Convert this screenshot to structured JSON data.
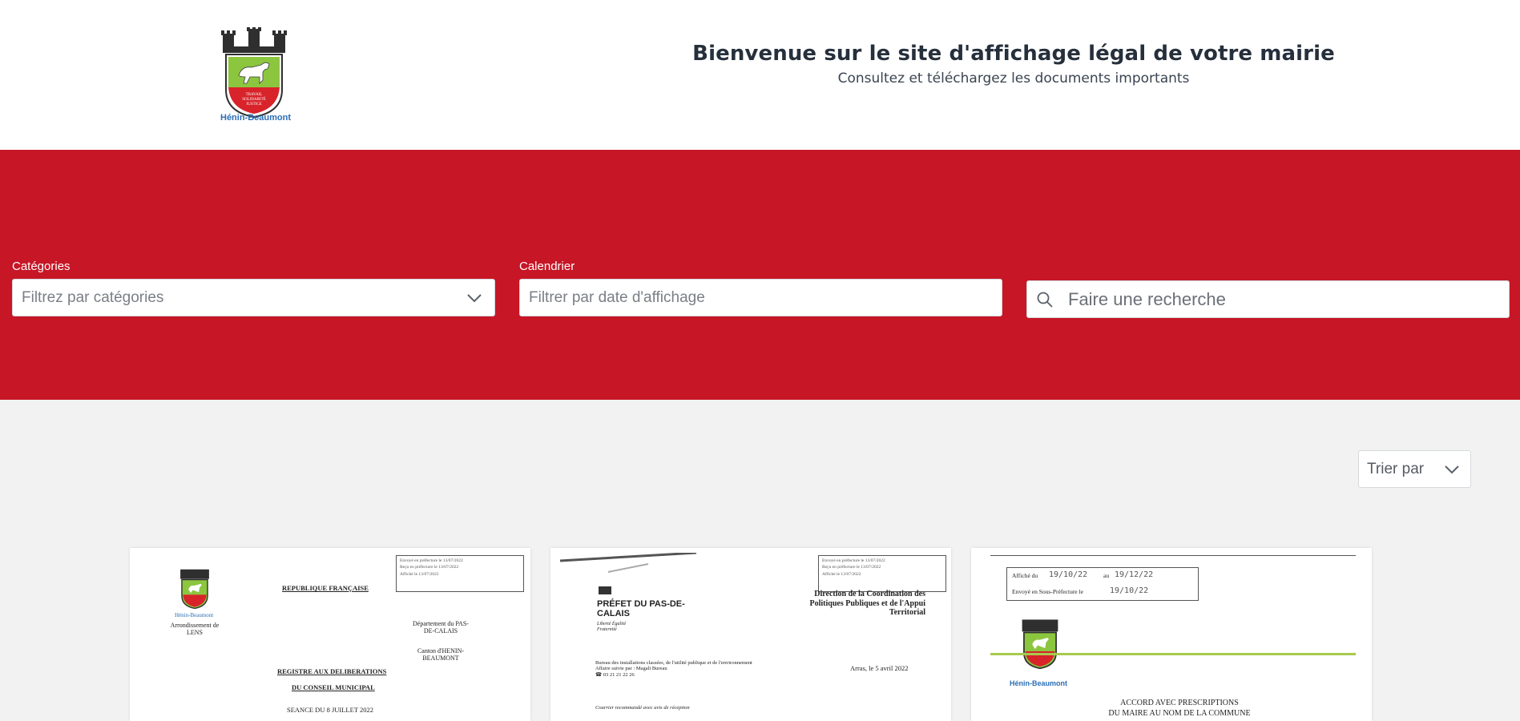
{
  "header": {
    "logo_caption": "Hénin-Beaumont",
    "logo_motto": "TRAVAIL SOLIDARITÉ JUSTICE",
    "title": "Bienvenue sur le site d'affichage légal de votre mairie",
    "subtitle": "Consultez et téléchargez les documents importants"
  },
  "filters": {
    "categories_label": "Catégories",
    "categories_placeholder": "Filtrez par catégories",
    "calendar_label": "Calendrier",
    "calendar_placeholder": "Filtrer par date d'affichage",
    "search_placeholder": "Faire une recherche"
  },
  "sort": {
    "label": "Trier par"
  },
  "cards": [
    {
      "republique": "REPUBLIQUE FRANÇAISE",
      "arrondissement": "Arrondissement de LENS",
      "departement": "Département du PAS-DE-CALAIS",
      "canton": "Canton d'HENIN-BEAUMONT",
      "registre": "REGISTRE AUX DELIBERATIONS",
      "conseil": "DU CONSEIL MUNICIPAL",
      "seance": "SEANCE DU 8 JUILLET 2022",
      "logo_caption": "Hénin-Beaumont"
    },
    {
      "prefet": "PRÉFET DU PAS-DE-CALAIS",
      "devise": "Liberté Égalité Fraternité",
      "direction": "Direction de la Coordination des Politiques Publiques et de l'Appui Territorial",
      "date": "Arras, le 5 avril 2022"
    },
    {
      "affiche_du": "Affiché du",
      "affiche_du_val": "19/10/22",
      "au": "au",
      "au_val": "19/12/22",
      "envoye": "Envoyé en Sous-Préfecture le",
      "envoye_val": "19/10/22",
      "logo_caption": "Hénin-Beaumont",
      "accord_line1": "ACCORD AVEC PRESCRIPTIONS",
      "accord_line2": "DU MAIRE AU NOM DE LA COMMUNE"
    }
  ],
  "colors": {
    "brand_red": "#c71626",
    "title": "#26303c",
    "logo_green": "#8cc63f",
    "logo_blue": "#2a6db5"
  }
}
